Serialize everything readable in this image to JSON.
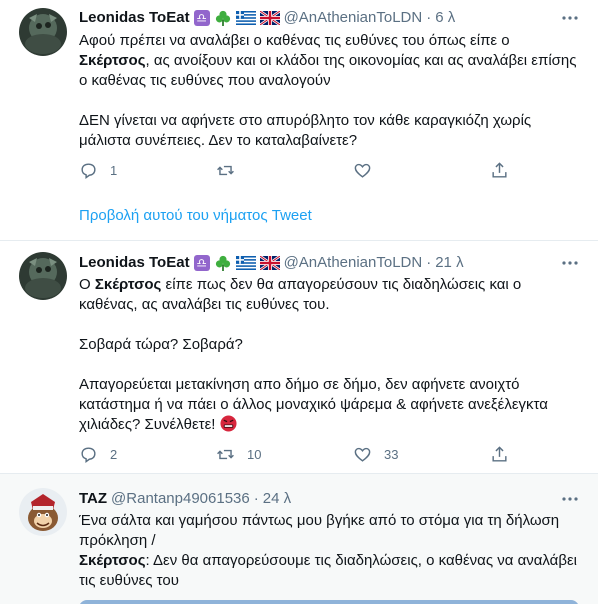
{
  "tweets": [
    {
      "name": "Leonidas ToEat",
      "handle": "@AnAthenianToLDN",
      "time": "6 λ",
      "body": {
        "p1_a": "Αφού πρέπει να αναλάβει ο καθένας τις ευθύνες του όπως είπε ο ",
        "p1_b": "Σκέρτσος",
        "p1_c": ", ας ανοίξουν και οι κλάδοι της οικονομίας και ας αναλάβει επίσης ο καθένας τις ευθύνες που αναλογούν",
        "p2": "ΔΕΝ γίνεται να αφήνετε στο απυρόβλητο τον κάθε καραγκιόζη χωρίς μάλιστα συνέπειες. Δεν το καταλαβαίνετε?"
      },
      "actions": {
        "reply_count": "1",
        "retweet_count": "",
        "like_count": ""
      },
      "thread_link": "Προβολή αυτού του νήματος Tweet"
    },
    {
      "name": "Leonidas ToEat",
      "handle": "@AnAthenianToLDN",
      "time": "21 λ",
      "body": {
        "p1_a": "Ο ",
        "p1_b": "Σκέρτσος",
        "p1_c": " είπε πως δεν θα απαγορεύσουν τις διαδηλώσεις και ο καθένας, ας αναλάβει τις ευθύνες του.",
        "p2": "Σοβαρά τώρα? Σοβαρά?",
        "p3": "Απαγορεύεται μετακίνηση απο δήμο σε δήμο, δεν αφήνετε ανοιχτό κατάστημα ή να πάει ο άλλος μοναχικό ψάρεμα & αφήνετε ανεξέλεγκτα χιλιάδες? Συνέλθετε!"
      },
      "actions": {
        "reply_count": "2",
        "retweet_count": "10",
        "like_count": "33"
      }
    },
    {
      "name": "TAZ",
      "handle": "@Rantanp49061536",
      "time": "24 λ",
      "body": {
        "p1": "Ένα σάλτα και γαμήσου πάντως μου βγήκε από το στόμα για τη δήλωση πρόκληση /",
        "p2_a": "Σκέρτσος",
        "p2_b": ": Δεν θα απαγορεύσουμε τις διαδηλώσεις, ο καθένας να αναλάβει τις ευθύνες του"
      }
    }
  ],
  "icons": {
    "more": "more-horizontal-icon",
    "reply": "reply-icon",
    "retweet": "retweet-icon",
    "like": "heart-icon",
    "share": "share-icon",
    "zodiac": "libra-icon",
    "shamrock": "shamrock-icon",
    "greek_flag": "greek-flag-icon",
    "uk_flag": "uk-flag-icon",
    "angry_face": "angry-face-icon"
  },
  "colors": {
    "link": "#1da1f2",
    "secondary_text": "#5b7083",
    "divider": "#e6ecf0",
    "highlight_bg": "#f7f9f9"
  }
}
